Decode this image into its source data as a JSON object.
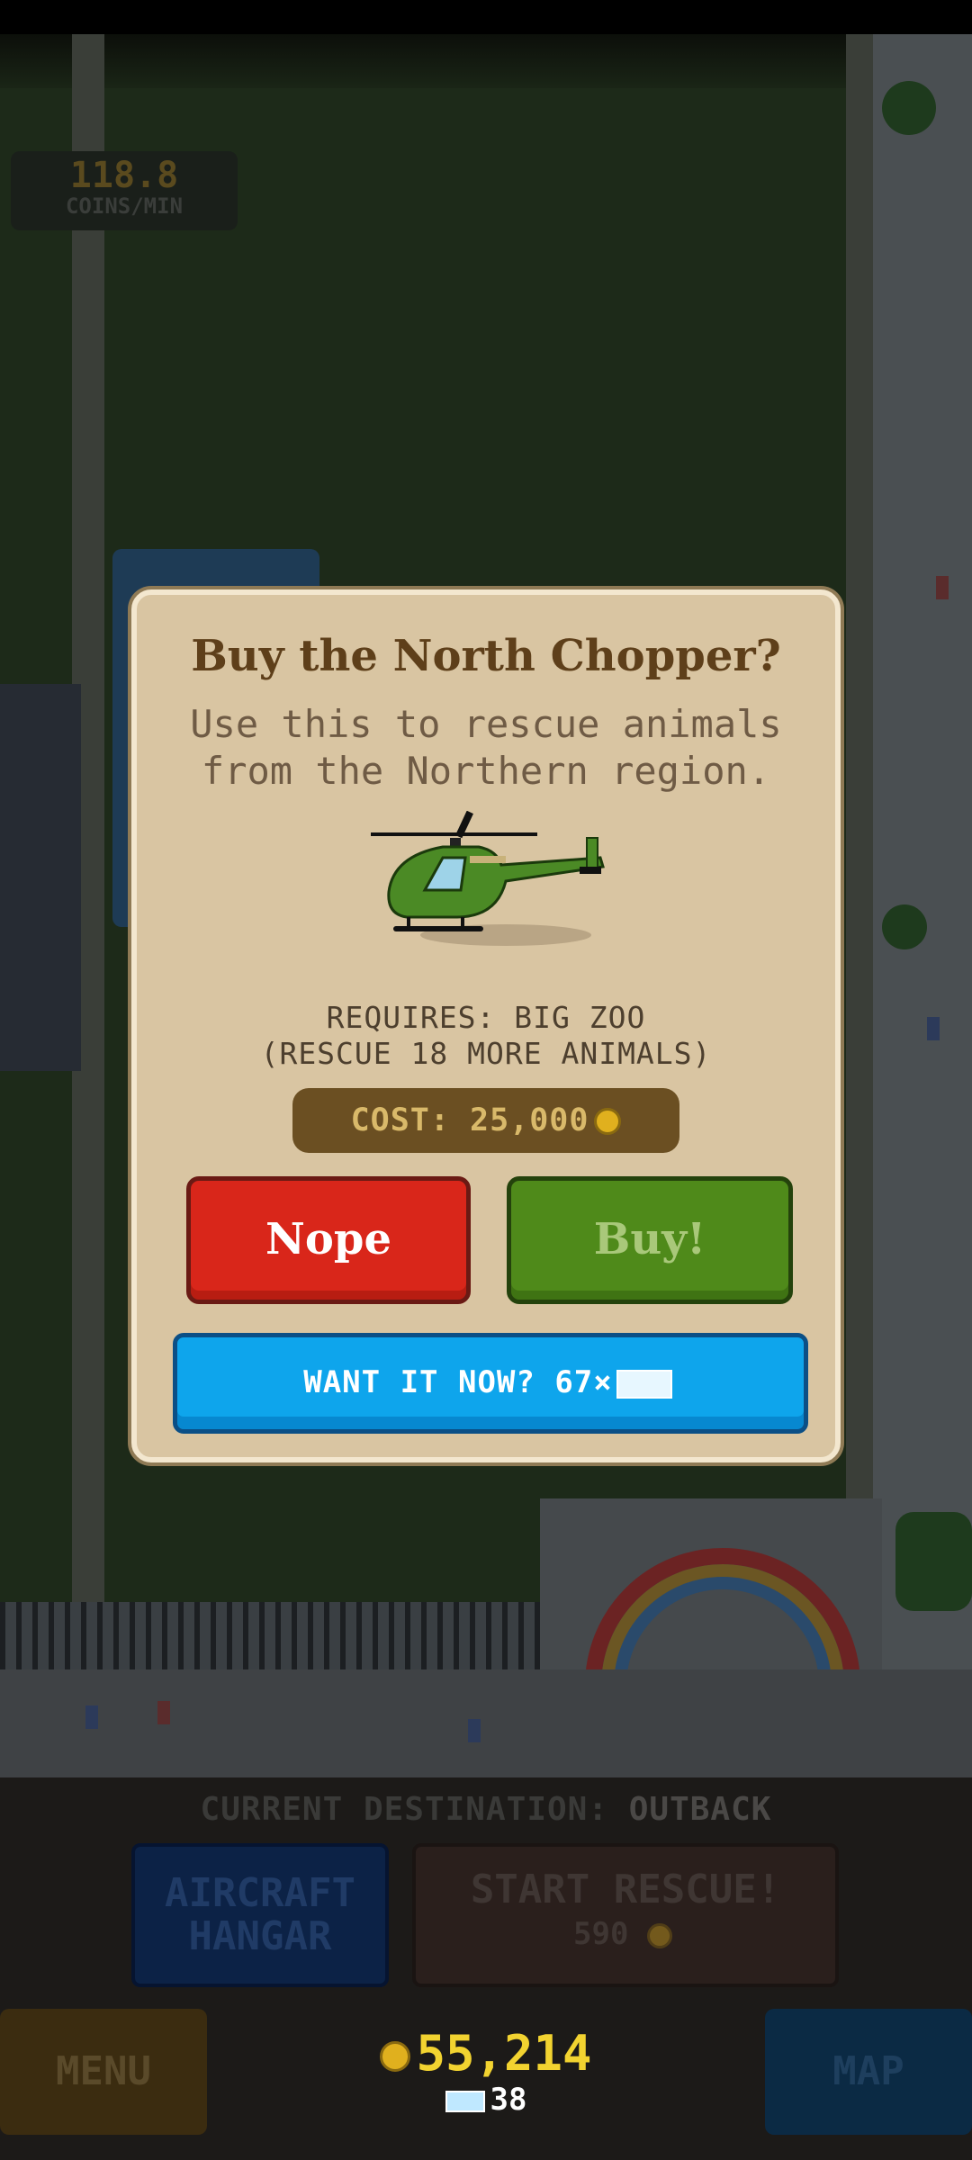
{
  "hud": {
    "coins_per_min_value": "118.8",
    "coins_per_min_label": "COINS/MIN"
  },
  "dialog": {
    "title": "Buy the North Chopper?",
    "description_line1": "Use this to rescue animals",
    "description_line2": "from the Northern region.",
    "requires_line1": "REQUIRES: BIG ZOO",
    "requires_line2": "(RESCUE 18 MORE ANIMALS)",
    "cost_label": "COST: 25,000",
    "nope_label": "Nope",
    "buy_label": "Buy!",
    "want_now_label": "WANT IT NOW? 67×",
    "item_icon": "green-helicopter",
    "colors": {
      "nope": "#d9261a",
      "buy": "#4f8a1a",
      "want_now": "#0ea5ec",
      "panel": "#d9c5a2"
    }
  },
  "bottom": {
    "destination_label": "CURRENT DESTINATION:",
    "destination_value": "OUTBACK",
    "hangar_line1": "AIRCRAFT",
    "hangar_line2": "HANGAR",
    "start_rescue_label": "START RESCUE!",
    "start_rescue_cost": "590",
    "menu_label": "MENU",
    "map_label": "MAP",
    "coins": "55,214",
    "gems": "38"
  }
}
